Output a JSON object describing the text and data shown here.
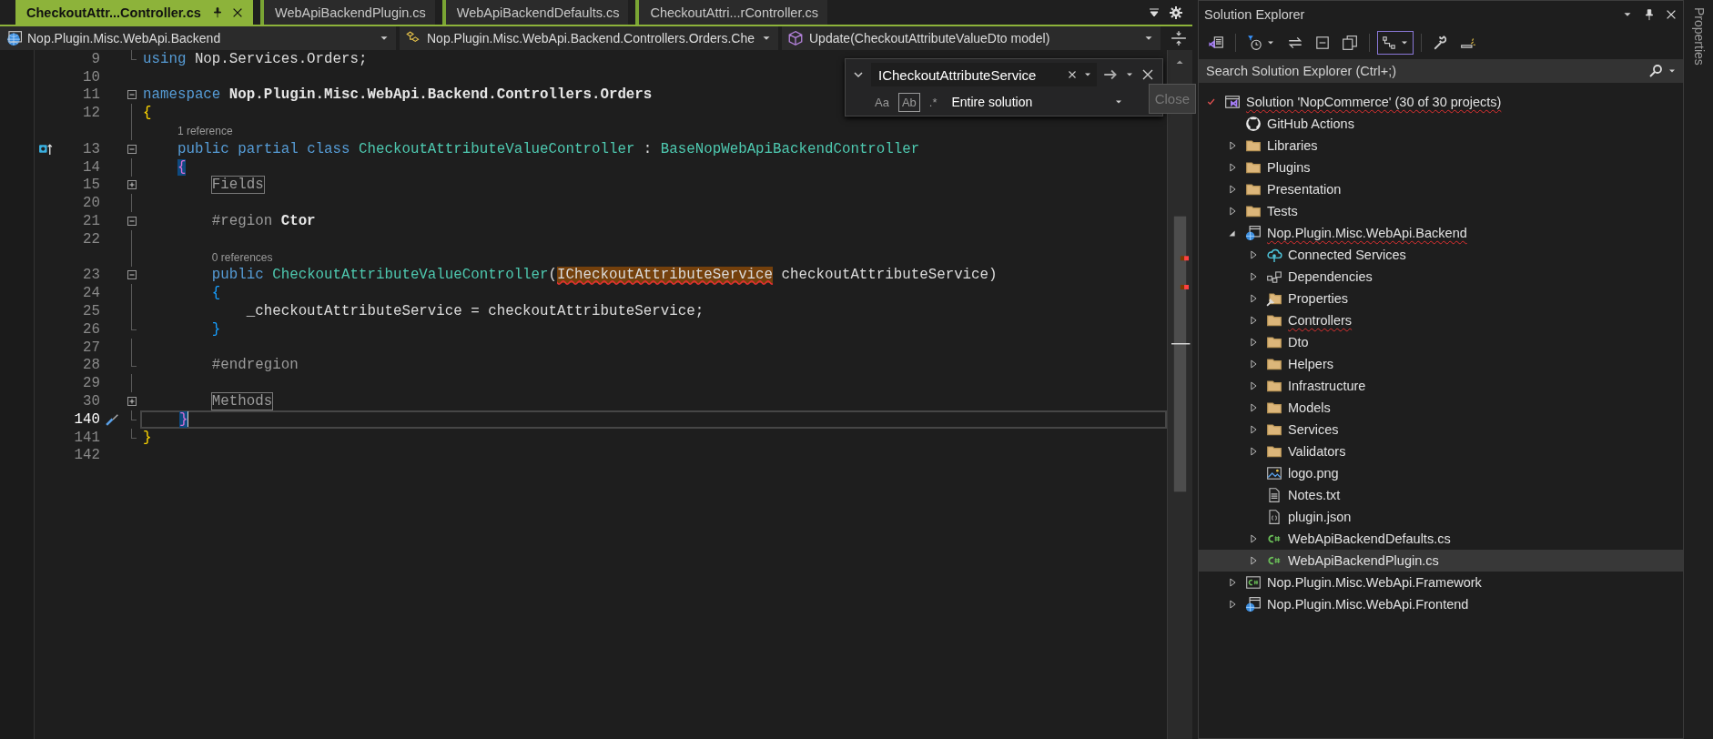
{
  "tabs": [
    {
      "label": "CheckoutAttr...Controller.cs",
      "selected": true
    },
    {
      "label": "WebApiBackendPlugin.cs",
      "selected": false
    },
    {
      "label": "WebApiBackendDefaults.cs",
      "selected": false
    },
    {
      "label": "CheckoutAttri...rController.cs",
      "selected": false
    }
  ],
  "nav_bar": [
    {
      "kind": "project",
      "text": "Nop.Plugin.Misc.WebApi.Backend"
    },
    {
      "kind": "type",
      "text": "Nop.Plugin.Misc.WebApi.Backend.Controllers.Orders.Che"
    },
    {
      "kind": "member",
      "text": "Update(CheckoutAttributeValueDto model)"
    }
  ],
  "find_widget": {
    "value": "ICheckoutAttributeService",
    "scope": "Entire solution",
    "options": [
      {
        "label": "Aa",
        "on": false
      },
      {
        "label": "Ab",
        "on": true
      },
      {
        "label": ".*",
        "on": false
      }
    ]
  },
  "tooltip": "Close",
  "code_lines": [
    {
      "kind": "code",
      "number": "9",
      "current": false,
      "fold": {
        "kind": "end"
      },
      "tokens": [
        {
          "text": "using",
          "kind": "keyword"
        },
        {
          "text": " Nop.Services.Orders;",
          "kind": "plain"
        }
      ]
    },
    {
      "kind": "code",
      "number": "10",
      "current": false
    },
    {
      "kind": "code",
      "number": "11",
      "current": false,
      "fold": {
        "kind": "open"
      },
      "tokens": [
        {
          "text": "namespace",
          "kind": "keyword"
        },
        {
          "text": " Nop.Plugin.Misc.WebApi.Backend.Controllers.Orders",
          "kind": "name"
        }
      ]
    },
    {
      "kind": "code",
      "number": "12",
      "current": false,
      "fold": {
        "kind": "guide"
      },
      "tokens": [
        {
          "text": "{",
          "kind": "brace-gold"
        }
      ]
    },
    {
      "kind": "lens",
      "text": "    1 reference",
      "fold": {
        "kind": "guide"
      }
    },
    {
      "kind": "code",
      "number": "13",
      "current": false,
      "gutter_icon": {
        "kind": "implements"
      },
      "fold": {
        "kind": "open"
      },
      "tokens": [
        {
          "text": "    public",
          "kind": "keyword"
        },
        {
          "text": " partial",
          "kind": "keyword"
        },
        {
          "text": " class",
          "kind": "keyword"
        },
        {
          "text": " CheckoutAttributeValueController",
          "kind": "type"
        },
        {
          "text": " : ",
          "kind": "plain"
        },
        {
          "text": "BaseNopWebApiBackendController",
          "kind": "type"
        }
      ]
    },
    {
      "kind": "code",
      "number": "14",
      "current": false,
      "fold": {
        "kind": "guide"
      },
      "tokens": [
        {
          "text": "    {",
          "kind": "brace-match"
        }
      ]
    },
    {
      "kind": "code",
      "number": "15",
      "current": false,
      "fold": {
        "kind": "closed"
      },
      "tokens": [
        {
          "text": "        Fields",
          "kind": "collapsed"
        }
      ]
    },
    {
      "kind": "code",
      "number": "20",
      "current": false,
      "fold": {
        "kind": "guide"
      }
    },
    {
      "kind": "code",
      "number": "21",
      "current": false,
      "fold": {
        "kind": "open"
      },
      "tokens": [
        {
          "text": "        #region",
          "kind": "directive"
        },
        {
          "text": " Ctor",
          "kind": "name"
        }
      ]
    },
    {
      "kind": "code",
      "number": "22",
      "current": false,
      "fold": {
        "kind": "guide"
      }
    },
    {
      "kind": "lens",
      "text": "        0 references",
      "fold": {
        "kind": "guide"
      }
    },
    {
      "kind": "code",
      "number": "23",
      "current": false,
      "fold": {
        "kind": "open"
      },
      "tokens": [
        {
          "text": "        public",
          "kind": "keyword"
        },
        {
          "text": " CheckoutAttributeValueController",
          "kind": "type"
        },
        {
          "text": "(",
          "kind": "plain"
        },
        {
          "text": "ICheckoutAttributeService",
          "kind": "find-match"
        },
        {
          "text": " checkoutAttributeService)",
          "kind": "plain"
        }
      ]
    },
    {
      "kind": "code",
      "number": "24",
      "current": false,
      "fold": {
        "kind": "guide"
      },
      "tokens": [
        {
          "text": "        {",
          "kind": "brace-blue"
        }
      ]
    },
    {
      "kind": "code",
      "number": "25",
      "current": false,
      "fold": {
        "kind": "guide"
      },
      "tokens": [
        {
          "text": "            _checkoutAttributeService = checkoutAttributeService;",
          "kind": "plain"
        }
      ]
    },
    {
      "kind": "code",
      "number": "26",
      "current": false,
      "fold": {
        "kind": "end"
      },
      "tokens": [
        {
          "text": "        }",
          "kind": "brace-blue"
        }
      ]
    },
    {
      "kind": "code",
      "number": "27",
      "current": false,
      "fold": {
        "kind": "guide"
      }
    },
    {
      "kind": "code",
      "number": "28",
      "current": false,
      "fold": {
        "kind": "end"
      },
      "tokens": [
        {
          "text": "        #endregion",
          "kind": "directive"
        }
      ]
    },
    {
      "kind": "code",
      "number": "29",
      "current": false,
      "fold": {
        "kind": "guide"
      }
    },
    {
      "kind": "code",
      "number": "30",
      "current": false,
      "fold": {
        "kind": "closed"
      },
      "tokens": [
        {
          "text": "        Methods",
          "kind": "collapsed"
        }
      ]
    },
    {
      "kind": "code",
      "number": "140",
      "current": true,
      "gutter_icon": {
        "kind": "quick-action"
      },
      "fold": {
        "kind": "end"
      },
      "tokens": [
        {
          "text": "    }",
          "kind": "brace-match"
        }
      ]
    },
    {
      "kind": "code",
      "number": "141",
      "current": false,
      "fold": {
        "kind": "end"
      },
      "tokens": [
        {
          "text": "}",
          "kind": "brace-gold"
        }
      ]
    },
    {
      "kind": "code",
      "number": "142",
      "current": false
    }
  ],
  "solution_explorer": {
    "title": "Solution Explorer",
    "toolbar": [
      {
        "kind": "home",
        "pressed": false,
        "dropdown": false
      },
      {
        "kind": "pending",
        "pressed": false,
        "dropdown": true
      },
      {
        "kind": "sync",
        "pressed": false,
        "dropdown": false
      },
      {
        "kind": "collapse",
        "pressed": false,
        "dropdown": false
      },
      {
        "kind": "copies",
        "pressed": false,
        "dropdown": false
      },
      {
        "kind": "view",
        "pressed": true,
        "dropdown": true
      },
      {
        "kind": "wrench",
        "pressed": false,
        "dropdown": false
      },
      {
        "kind": "preview",
        "pressed": false,
        "dropdown": false
      }
    ],
    "search": {
      "placeholder": "Search Solution Explorer (Ctrl+;)"
    },
    "tree": [
      {
        "label": "Solution 'NopCommerce' (30 of 30 projects)",
        "kind": "solution",
        "checked_in": true,
        "squiggle": true,
        "selected": false,
        "children": [
          {
            "label": "GitHub Actions",
            "kind": "github",
            "squiggle": false,
            "selected": false
          },
          {
            "label": "Libraries",
            "kind": "folder",
            "squiggle": false,
            "selected": false,
            "expanded": false
          },
          {
            "label": "Plugins",
            "kind": "folder",
            "squiggle": false,
            "selected": false,
            "expanded": false
          },
          {
            "label": "Presentation",
            "kind": "folder",
            "squiggle": false,
            "selected": false,
            "expanded": false
          },
          {
            "label": "Tests",
            "kind": "folder",
            "squiggle": false,
            "selected": false,
            "expanded": false
          },
          {
            "label": "Nop.Plugin.Misc.WebApi.Backend",
            "kind": "web-project",
            "squiggle": true,
            "selected": false,
            "expanded": true,
            "children": [
              {
                "label": "Connected Services",
                "kind": "cloud",
                "squiggle": false,
                "selected": false,
                "expanded": false
              },
              {
                "label": "Dependencies",
                "kind": "dependencies",
                "squiggle": false,
                "selected": false,
                "expanded": false
              },
              {
                "label": "Properties",
                "kind": "properties",
                "squiggle": false,
                "selected": false,
                "expanded": false
              },
              {
                "label": "Controllers",
                "kind": "folder",
                "squiggle": true,
                "selected": false,
                "expanded": false
              },
              {
                "label": "Dto",
                "kind": "folder",
                "squiggle": false,
                "selected": false,
                "expanded": false
              },
              {
                "label": "Helpers",
                "kind": "folder",
                "squiggle": false,
                "selected": false,
                "expanded": false
              },
              {
                "label": "Infrastructure",
                "kind": "folder",
                "squiggle": false,
                "selected": false,
                "expanded": false
              },
              {
                "label": "Models",
                "kind": "folder",
                "squiggle": false,
                "selected": false,
                "expanded": false
              },
              {
                "label": "Services",
                "kind": "folder",
                "squiggle": false,
                "selected": false,
                "expanded": false
              },
              {
                "label": "Validators",
                "kind": "folder",
                "squiggle": false,
                "selected": false,
                "expanded": false
              },
              {
                "label": "logo.png",
                "kind": "image",
                "squiggle": false,
                "selected": false
              },
              {
                "label": "Notes.txt",
                "kind": "text-file",
                "squiggle": false,
                "selected": false
              },
              {
                "label": "plugin.json",
                "kind": "json-file",
                "squiggle": false,
                "selected": false
              },
              {
                "label": "WebApiBackendDefaults.cs",
                "kind": "csharp",
                "squiggle": false,
                "selected": false,
                "expanded": false
              },
              {
                "label": "WebApiBackendPlugin.cs",
                "kind": "csharp",
                "squiggle": false,
                "selected": true,
                "expanded": false
              }
            ]
          },
          {
            "label": "Nop.Plugin.Misc.WebApi.Framework",
            "kind": "csharp-project",
            "squiggle": false,
            "selected": false,
            "expanded": false
          },
          {
            "label": "Nop.Plugin.Misc.WebApi.Frontend",
            "kind": "web-project",
            "squiggle": false,
            "selected": false,
            "expanded": false
          }
        ]
      }
    ]
  },
  "properties_strip": {
    "label": "Properties"
  }
}
